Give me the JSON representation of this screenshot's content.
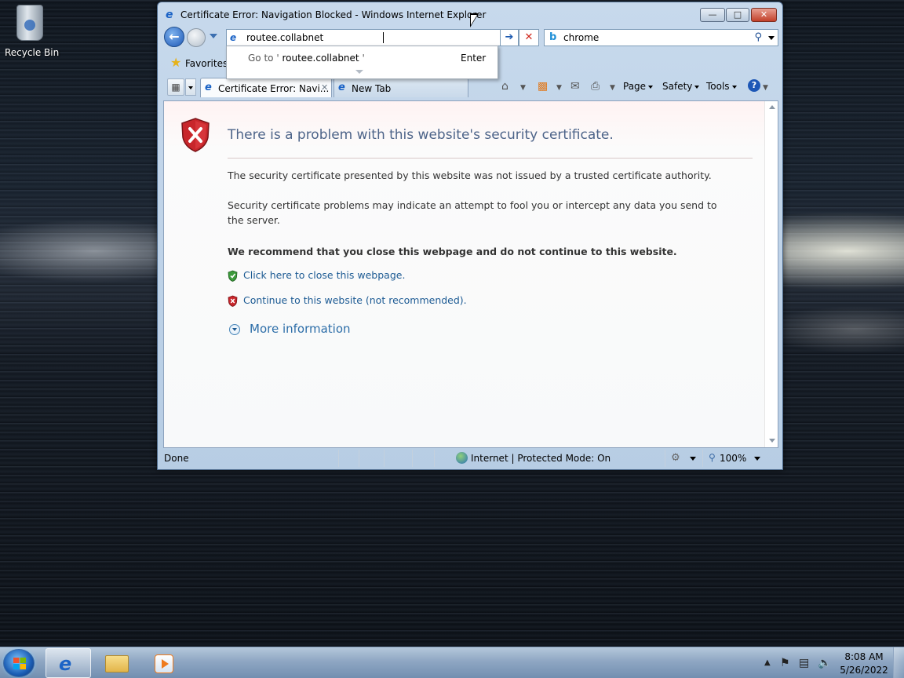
{
  "desktop": {
    "icons": [
      {
        "label": "Recycle Bin",
        "icon": "recycle-bin-icon"
      }
    ]
  },
  "window": {
    "title": "Certificate Error: Navigation Blocked - Windows Internet Explorer",
    "controls": {
      "minimize": "minimize",
      "maximize": "maximize",
      "close": "close"
    }
  },
  "navbar": {
    "address_value": "routee.collabnet",
    "search_value": "chrome",
    "search_provider_icon": "bing-icon"
  },
  "autocomplete": {
    "prefix": "Go to '",
    "target": "routee.collabnet",
    "suffix": "'",
    "hint": "Enter"
  },
  "favorites": {
    "label": "Favorites"
  },
  "tabs": [
    {
      "label": "Certificate Error: Navi...",
      "active": true
    },
    {
      "label": "New Tab",
      "active": false
    }
  ],
  "commandbar": {
    "page": "Page",
    "safety": "Safety",
    "tools": "Tools"
  },
  "page": {
    "title": "There is a problem with this website's security certificate.",
    "p1": "The security certificate presented by this website was not issued by a trusted certificate authority.",
    "p2": "Security certificate problems may indicate an attempt to fool you or intercept any data you send to the server.",
    "recommend": "We recommend that you close this webpage and do not continue to this website.",
    "close_link": "Click here to close this webpage.",
    "continue_link": "Continue to this website (not recommended).",
    "more_info": "More information"
  },
  "status": {
    "done": "Done",
    "zone": "Internet | Protected Mode: On",
    "zoom": "100%"
  },
  "taskbar": {
    "clock_time": "8:08 AM",
    "clock_date": "5/26/2022"
  },
  "colors": {
    "link": "#1c5a93",
    "title": "#4d6489",
    "shield_red": "#c8262b",
    "shield_green": "#3c9a3c"
  }
}
